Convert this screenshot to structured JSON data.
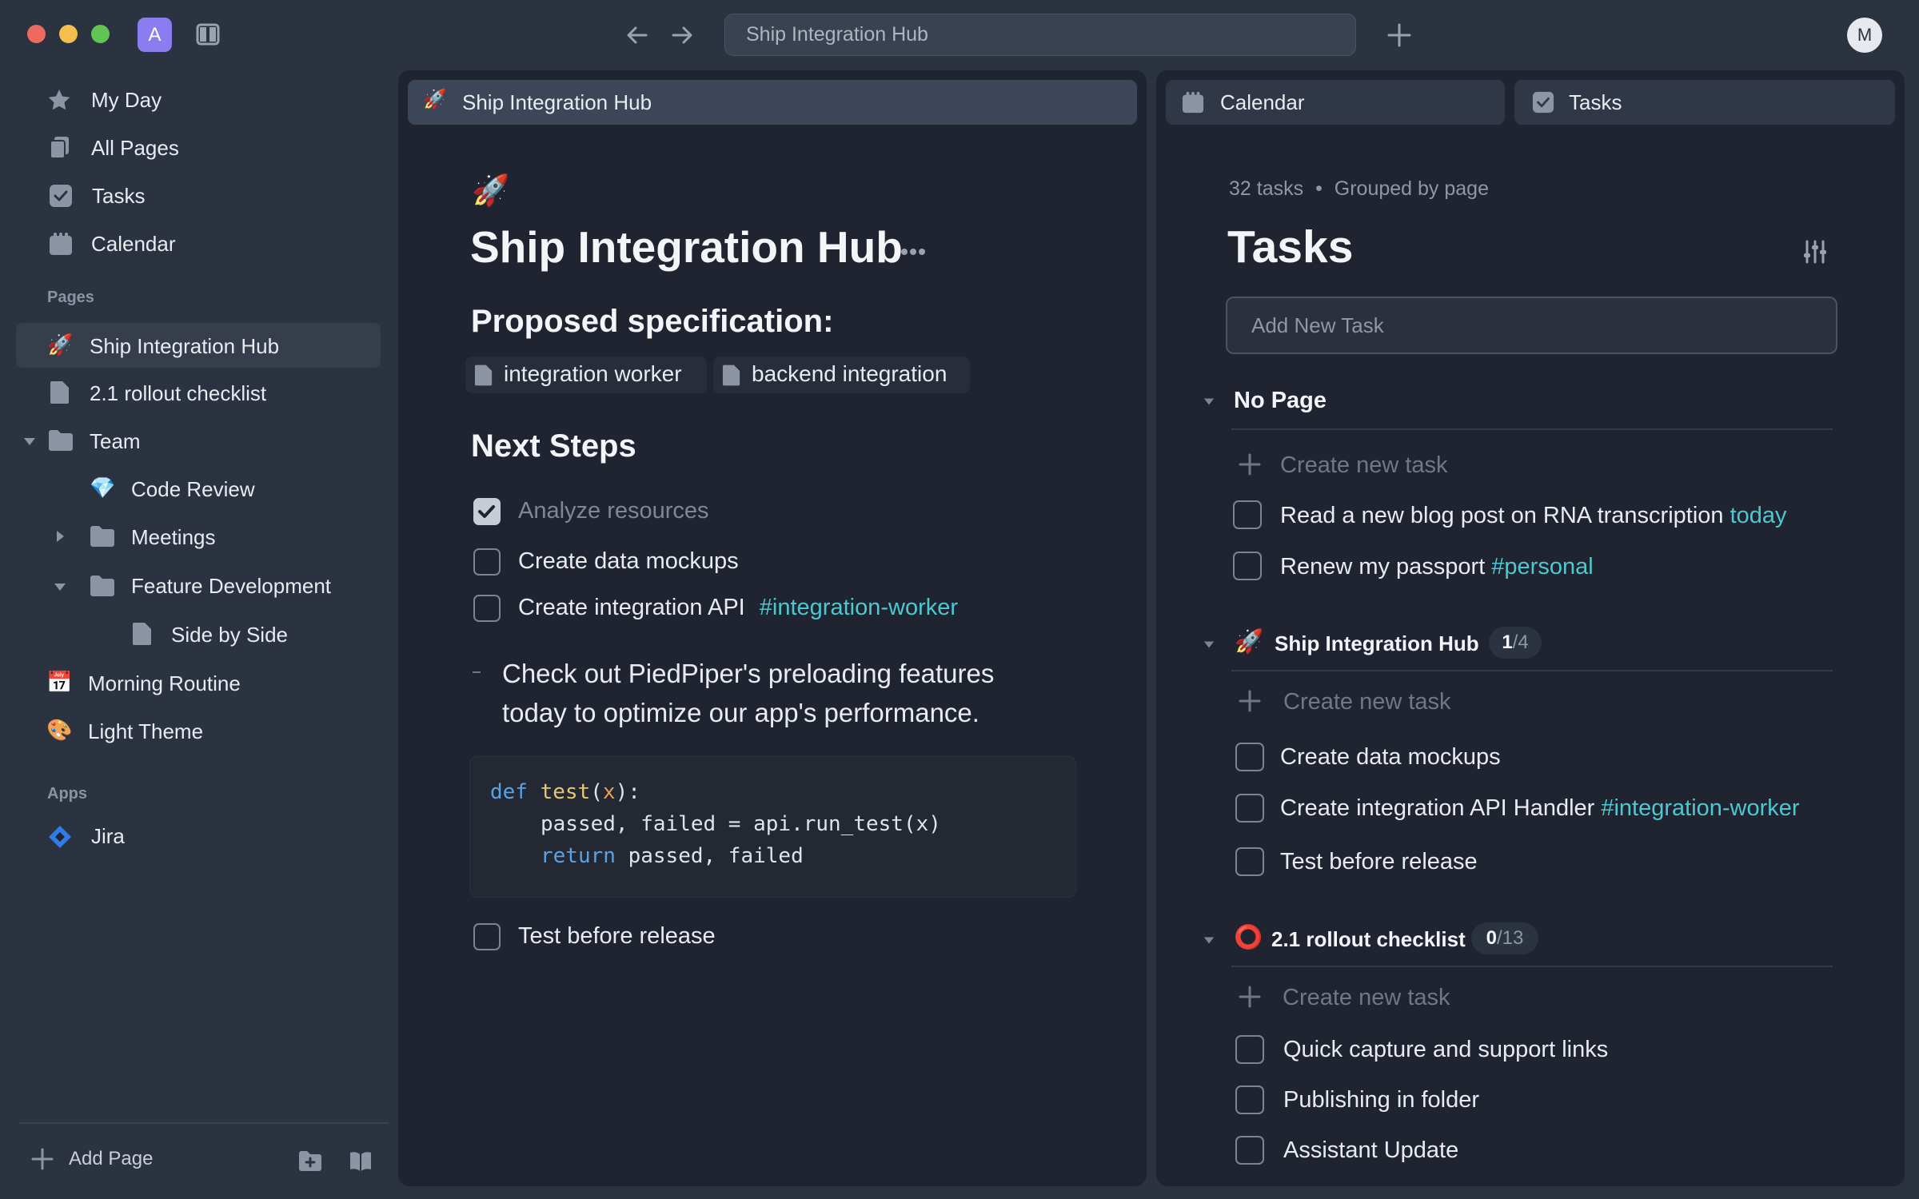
{
  "window": {
    "workspace_initial": "A",
    "address": "Ship Integration Hub",
    "user_initial": "M"
  },
  "sidebar": {
    "nav": [
      {
        "label": "My Day",
        "icon": "star-icon"
      },
      {
        "label": "All Pages",
        "icon": "pages-icon"
      },
      {
        "label": "Tasks",
        "icon": "checkbox-icon"
      },
      {
        "label": "Calendar",
        "icon": "calendar-icon"
      }
    ],
    "pages_heading": "Pages",
    "pages": [
      {
        "label": "Ship Integration Hub",
        "icon": "🚀",
        "active": true
      },
      {
        "label": "2.1 rollout checklist",
        "icon": "document-icon"
      },
      {
        "label": "Team",
        "icon": "folder-icon",
        "expanded": true
      },
      {
        "label": "Code Review",
        "icon": "💎"
      },
      {
        "label": "Meetings",
        "icon": "folder-icon",
        "expanded": false
      },
      {
        "label": "Feature Development",
        "icon": "folder-icon",
        "expanded": true
      },
      {
        "label": "Side by Side",
        "icon": "document-icon"
      },
      {
        "label": "Morning Routine",
        "icon": "📅"
      },
      {
        "label": "Light Theme",
        "icon": "🎨"
      }
    ],
    "apps_heading": "Apps",
    "apps": [
      {
        "label": "Jira",
        "icon": "jira-icon"
      }
    ],
    "add_page": "Add Page"
  },
  "page_panel": {
    "tab": "Ship Integration Hub",
    "icon": "🚀",
    "title": "Ship Integration Hub",
    "spec_heading": "Proposed specification:",
    "chips": [
      "integration worker",
      "backend integration"
    ],
    "next_steps_heading": "Next Steps",
    "todos": [
      {
        "text": "Analyze resources",
        "checked": true
      },
      {
        "text": "Create data mockups",
        "checked": false
      },
      {
        "text": "Create integration API",
        "tag": "#integration-worker",
        "checked": false
      }
    ],
    "bullet": "Check out PiedPiper's preloading features today to optimize our app's performance.",
    "code": {
      "line1": {
        "kw": "def",
        "fn": "test",
        "open": "(",
        "arg": "x",
        "close": "):"
      },
      "line2": "passed, failed = api.run_test(x)",
      "line3": {
        "kw": "return",
        "rest": " passed, failed"
      }
    },
    "final_todo": {
      "text": "Test before release",
      "checked": false
    }
  },
  "tabs": {
    "calendar": "Calendar",
    "tasks": "Tasks"
  },
  "tasks_panel": {
    "count_label": "32 tasks",
    "separator": "•",
    "grouping": "Grouped by page",
    "title": "Tasks",
    "add_placeholder": "Add New Task",
    "create_label": "Create new task",
    "groups": [
      {
        "title": "No Page",
        "tasks": [
          {
            "text": "Read a new blog post on RNA transcription",
            "tag": "today"
          },
          {
            "text": "Renew my passport",
            "tag": "#personal"
          }
        ]
      },
      {
        "title": "Ship Integration Hub",
        "icon": "🚀",
        "done": "1",
        "total": "/4",
        "tasks": [
          {
            "text": "Create data mockups"
          },
          {
            "text": "Create integration API Handler",
            "tag": "#integration-worker"
          },
          {
            "text": "Test before release"
          }
        ]
      },
      {
        "title": "2.1 rollout checklist",
        "icon": "⭕",
        "done": "0",
        "total": "/13",
        "tasks": [
          {
            "text": "Quick capture and support links"
          },
          {
            "text": "Publishing in folder"
          },
          {
            "text": "Assistant Update"
          }
        ]
      }
    ]
  },
  "colors": {
    "background": "#2b3240",
    "panel": "#1f2430",
    "accent_tag": "#4cc9d0",
    "workspace_avatar": "#8b7cf0"
  }
}
